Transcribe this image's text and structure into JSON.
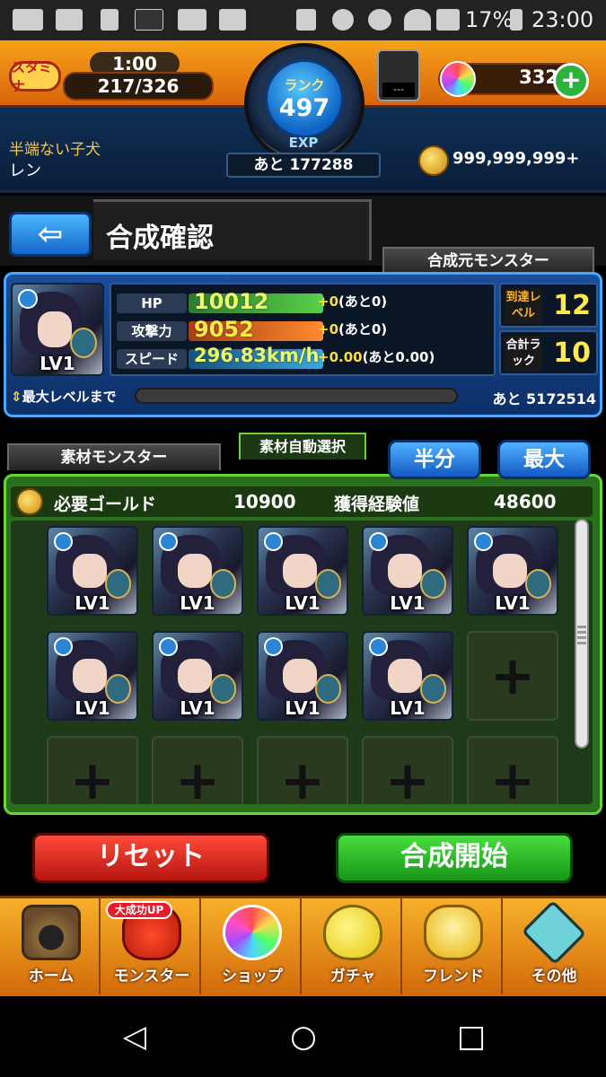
{
  "status_bar": {
    "battery": "17%",
    "time": "23:00",
    "icons": [
      "message-icon",
      "au-mail-icon",
      "usb-icon",
      "app-icon",
      "wowma-icon",
      "music-pass-icon",
      "nfc-icon",
      "dnd-icon",
      "alarm-icon",
      "wifi-icon",
      "signal-icon",
      "battery-icon"
    ]
  },
  "header": {
    "stamina_label": "スタミナ",
    "stamina_timer": "1:00",
    "stamina_value": "217/326",
    "rank_label": "ランク",
    "rank_value": "497",
    "exp_label": "EXP",
    "exp_remaining": "あと 177288",
    "item_box_value": "---",
    "orb_count": "332",
    "gold": "999,999,999+",
    "player_title": "半端ない子犬",
    "player_name": "レン"
  },
  "page": {
    "title": "合成確認",
    "back_icon": "back-arrow-icon"
  },
  "base_monster": {
    "tab_label": "合成元モンスター",
    "level": "LV1",
    "hp_label": "HP",
    "hp_value": "10012",
    "hp_plus": "+0",
    "hp_remain": "(あと0)",
    "atk_label": "攻撃力",
    "atk_value": "9052",
    "atk_plus": "+0",
    "atk_remain": "(あと0)",
    "spd_label": "スピード",
    "spd_value": "296.83km/h",
    "spd_plus": "+0.00",
    "spd_remain": "(あと0.00)",
    "reach_label": "到達レベル",
    "reach_value": "12",
    "luck_label": "合計ラック",
    "luck_value": "10",
    "max_label": "最大レベルまで",
    "max_remaining": "あと 5172514"
  },
  "materials": {
    "tab_label": "素材モンスター",
    "auto_select_label": "素材自動選択",
    "half_label": "半分",
    "max_label": "最大",
    "gold_label": "必要ゴールド",
    "gold_value": "10900",
    "exp_label": "獲得経験値",
    "exp_value": "48600",
    "slots": [
      "LV1",
      "LV1",
      "LV1",
      "LV1",
      "LV1",
      "LV1",
      "LV1",
      "LV1",
      "LV1"
    ],
    "empty_slot_symbol": "+"
  },
  "actions": {
    "reset_label": "リセット",
    "start_label": "合成開始"
  },
  "bottom_nav": {
    "badge": "大成功UP",
    "items": [
      {
        "label": "ホーム",
        "icon": "home-icon"
      },
      {
        "label": "モンスター",
        "icon": "monster-icon"
      },
      {
        "label": "ショップ",
        "icon": "shop-orb-icon"
      },
      {
        "label": "ガチャ",
        "icon": "gacha-egg-icon"
      },
      {
        "label": "フレンド",
        "icon": "friend-icon"
      },
      {
        "label": "その他",
        "icon": "other-icon"
      }
    ]
  },
  "android_nav": {
    "back": "◁",
    "home": "○",
    "recent": "□"
  },
  "colors": {
    "header_orange": "#f7a21a",
    "panel_blue": "#1d4e9a",
    "panel_green": "#2a6f1d",
    "button_blue": "#1459c2",
    "reset_red": "#b51610",
    "start_green": "#17951a",
    "stat_yellow": "#ffde38"
  }
}
